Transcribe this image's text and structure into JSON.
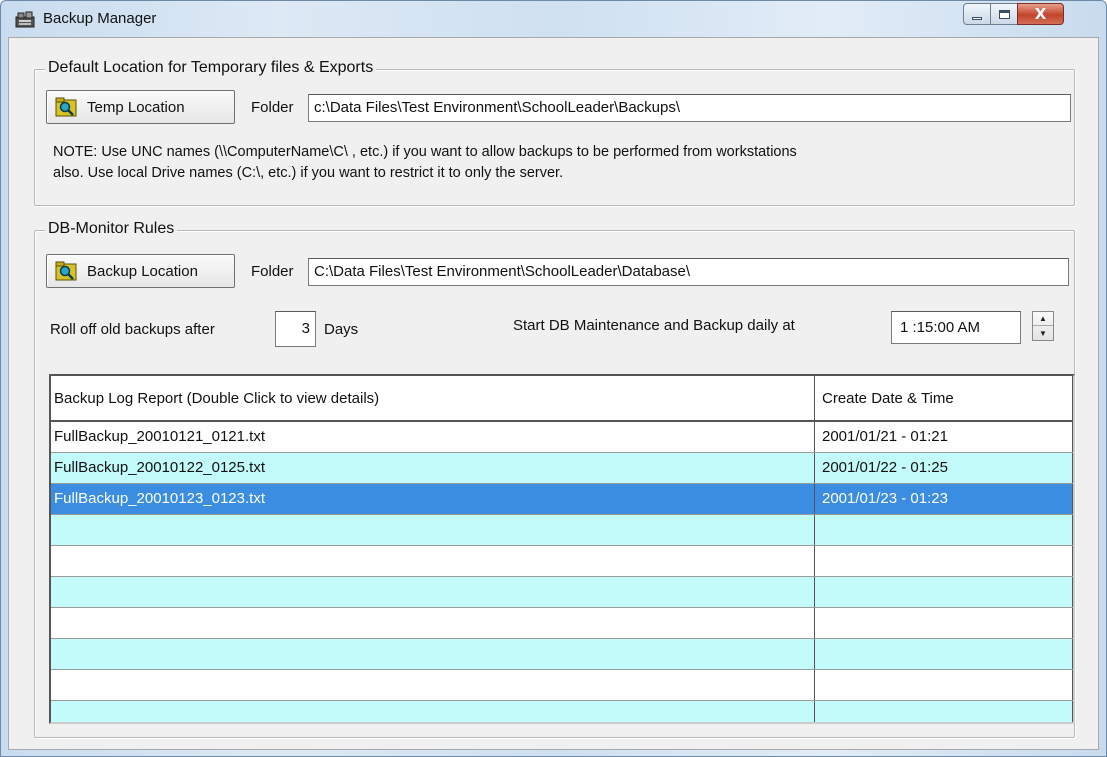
{
  "window": {
    "title": "Backup Manager"
  },
  "temp_group": {
    "legend": "Default Location for Temporary files & Exports",
    "button_label": "Temp Location",
    "folder_label": "Folder",
    "folder_value": "c:\\Data Files\\Test Environment\\SchoolLeader\\Backups\\",
    "note_line1": "NOTE: Use UNC names (\\\\ComputerName\\C\\ , etc.) if you want to allow backups to be performed from workstations",
    "note_line2": "also.  Use local Drive names (C:\\, etc.) if you want to restrict it to only the server."
  },
  "db_group": {
    "legend": "DB-Monitor Rules",
    "button_label": "Backup Location",
    "folder_label": "Folder",
    "folder_value": "C:\\Data Files\\Test Environment\\SchoolLeader\\Database\\",
    "rolloff_label": "Roll off old backups after",
    "rolloff_value": "3",
    "days_label": "Days",
    "maint_label": "Start DB Maintenance and Backup daily at",
    "maint_time": "1 :15:00 AM"
  },
  "log_table": {
    "columns": [
      "Backup Log Report  (Double Click to view details)",
      "Create Date & Time"
    ],
    "rows": [
      {
        "file": "FullBackup_20010121_0121.txt",
        "date": "2001/01/21 - 01:21"
      },
      {
        "file": "FullBackup_20010122_0125.txt",
        "date": "2001/01/22 - 01:25"
      },
      {
        "file": "FullBackup_20010123_0123.txt",
        "date": "2001/01/23 - 01:23"
      },
      {
        "file": "",
        "date": ""
      },
      {
        "file": "",
        "date": ""
      },
      {
        "file": "",
        "date": ""
      },
      {
        "file": "",
        "date": ""
      },
      {
        "file": "",
        "date": ""
      },
      {
        "file": "",
        "date": ""
      },
      {
        "file": "",
        "date": ""
      }
    ],
    "selected_index": 2
  },
  "colors": {
    "row_alt": "#c3fbfb",
    "row_selected": "#3a8de0",
    "dialog_bg": "#f0f0f0"
  },
  "icons": {
    "app": "backup-manager-icon",
    "browse": "folder-search-icon"
  }
}
